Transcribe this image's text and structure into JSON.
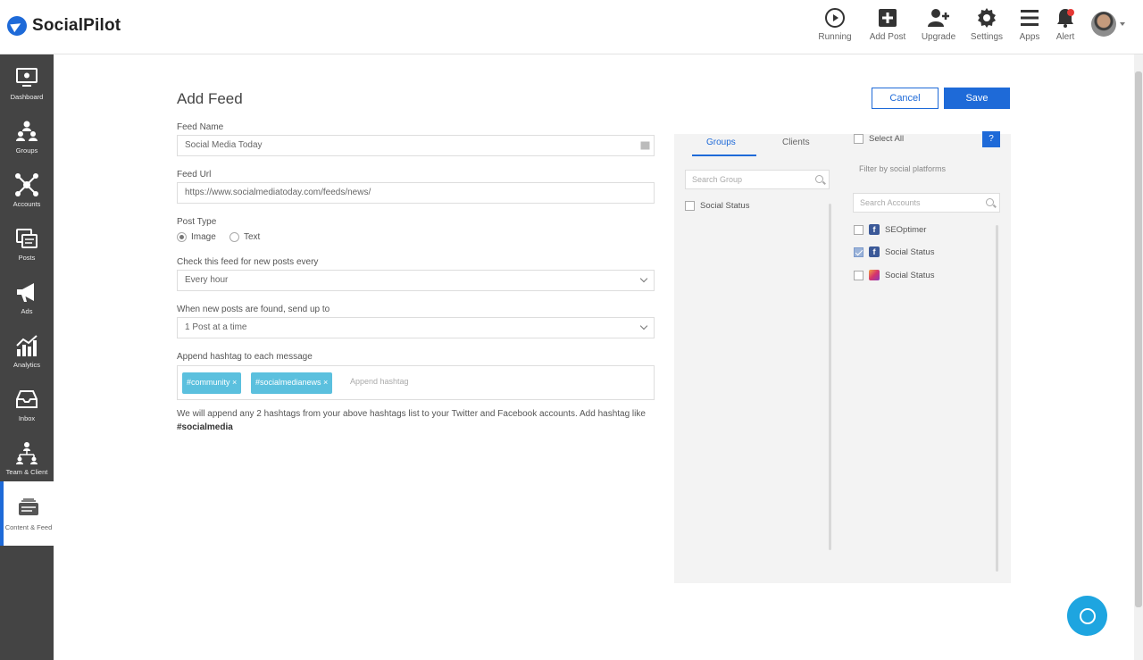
{
  "app": {
    "name": "SocialPilot"
  },
  "topnav": [
    {
      "key": "running",
      "label": "Running",
      "icon": "play-circle-icon"
    },
    {
      "key": "add-post",
      "label": "Add Post",
      "icon": "plus-square-icon"
    },
    {
      "key": "upgrade",
      "label": "Upgrade",
      "icon": "user-plus-icon"
    },
    {
      "key": "settings",
      "label": "Settings",
      "icon": "gear-icon"
    },
    {
      "key": "apps",
      "label": "Apps",
      "icon": "menu-icon"
    },
    {
      "key": "alert",
      "label": "Alert",
      "icon": "bell-icon"
    }
  ],
  "sidebar": {
    "items": [
      {
        "key": "dashboard",
        "label": "Dashboard",
        "icon": "monitor-icon"
      },
      {
        "key": "groups",
        "label": "Groups",
        "icon": "group-icon"
      },
      {
        "key": "accounts",
        "label": "Accounts",
        "icon": "network-icon"
      },
      {
        "key": "posts",
        "label": "Posts",
        "icon": "posts-icon"
      },
      {
        "key": "ads",
        "label": "Ads",
        "icon": "megaphone-icon"
      },
      {
        "key": "analytics",
        "label": "Analytics",
        "icon": "bar-chart-icon"
      },
      {
        "key": "inbox",
        "label": "Inbox",
        "icon": "inbox-icon"
      },
      {
        "key": "team-client",
        "label": "Team & Client",
        "icon": "team-icon"
      },
      {
        "key": "content-feed",
        "label": "Content & Feed",
        "icon": "feed-icon",
        "active": true
      }
    ]
  },
  "page": {
    "title": "Add Feed",
    "cancel_label": "Cancel",
    "save_label": "Save"
  },
  "form": {
    "feed_name_label": "Feed Name",
    "feed_name_value": "Social Media Today",
    "feed_url_label": "Feed Url",
    "feed_url_value": "https://www.socialmediatoday.com/feeds/news/",
    "post_type_label": "Post Type",
    "post_type_options": [
      "Image",
      "Text"
    ],
    "post_type_selected": "Image",
    "check_label": "Check this feed for new posts every",
    "check_value": "Every hour",
    "send_label": "When new posts are found, send up to",
    "send_value": "1 Post at a time",
    "hashtag_label": "Append hashtag to each message",
    "hashtags": [
      "#community ×",
      "#socialmedianews ×"
    ],
    "hashtag_placeholder": "Append hashtag",
    "note_text": "We will append any 2 hashtags from your above hashtags list to your Twitter and Facebook accounts. Add hashtag like",
    "note_example": "#socialmedia"
  },
  "selector": {
    "tabs": [
      "Groups",
      "Clients"
    ],
    "active_tab": "Groups",
    "group_search_placeholder": "Search Group",
    "groups": [
      "Social Status"
    ],
    "select_all_label": "Select All",
    "info_label": "?",
    "filter_label": "Filter by social platforms",
    "account_search_placeholder": "Search Accounts",
    "accounts": [
      {
        "name": "SEOptimer",
        "network": "facebook",
        "checked": false
      },
      {
        "name": "Social Status",
        "network": "facebook",
        "checked": true
      },
      {
        "name": "Social Status",
        "network": "instagram",
        "checked": false
      }
    ]
  },
  "colors": {
    "accent": "#1e6ad8",
    "sidebar_bg": "#444444",
    "tag_bg": "#5bc0de",
    "chat_bg": "#1ea5e0"
  }
}
